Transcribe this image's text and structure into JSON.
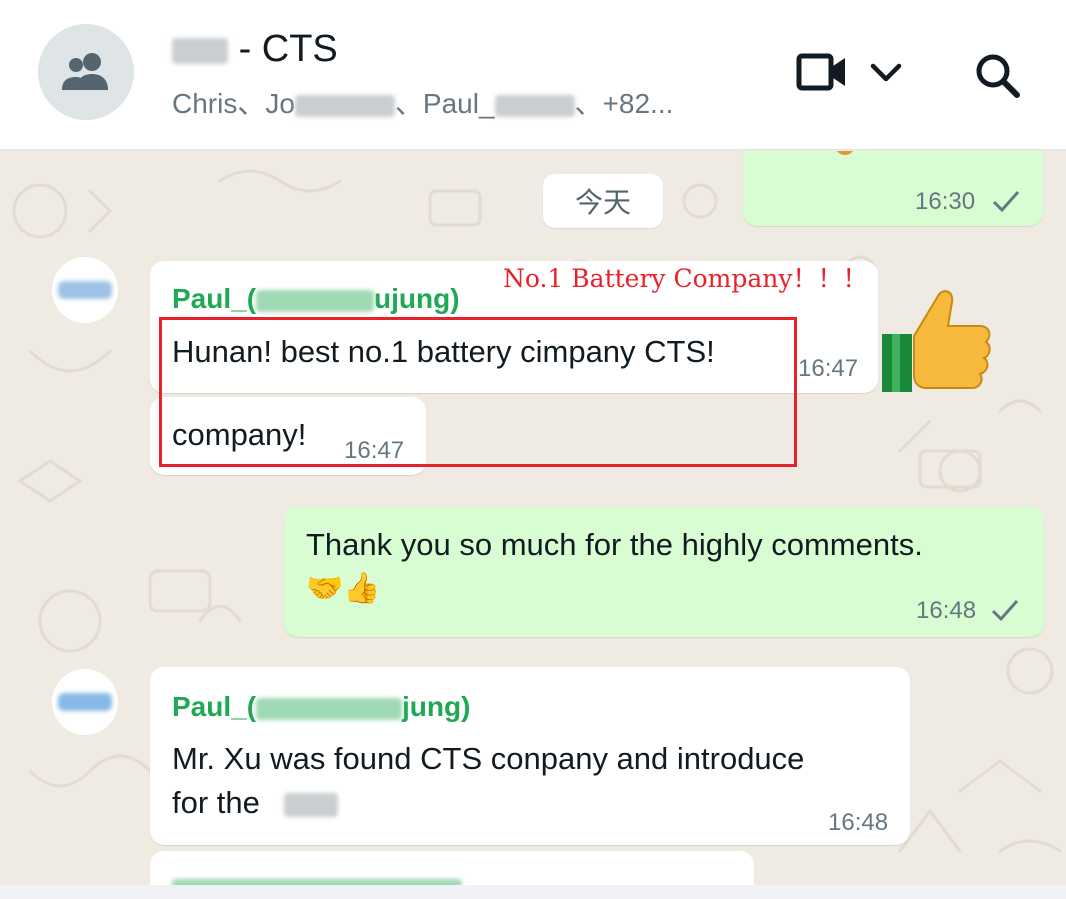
{
  "header": {
    "title": "- CTS",
    "members_text_1": "Chris、Jo",
    "members_text_2": "、Paul_",
    "members_text_3": "、+82...",
    "icons": [
      "group-icon",
      "video-call-icon",
      "chevron-down-icon",
      "search-icon"
    ]
  },
  "date_chip": "今天",
  "annotation": {
    "text": "No.1 Battery Company！！！",
    "color": "#e8222a"
  },
  "messages": [
    {
      "direction": "out",
      "text": "",
      "time": "16:30"
    },
    {
      "direction": "in",
      "sender": "Paul_(",
      "sender_suffix": "ujung)",
      "text": "Hunan!  best no.1 battery cimpany CTS!",
      "time": "16:47"
    },
    {
      "direction": "in",
      "text": "company!",
      "time": "16:47"
    },
    {
      "direction": "out",
      "text": "Thank you so much for the highly comments.",
      "emoji": "🤝👍",
      "time": "16:48"
    },
    {
      "direction": "in",
      "sender": "Paul_(",
      "sender_suffix": "jung)",
      "text_line1": "Mr. Xu was found  CTS conpany and introduce",
      "text_line2": "for the",
      "time": "16:48"
    }
  ],
  "colors": {
    "header_bg": "#ffffff",
    "chat_bg": "#efeae2",
    "incoming_bubble": "#ffffff",
    "outgoing_bubble": "#d9fdd3",
    "sender_name": "#1fa855",
    "annotation_red": "#e8222a"
  }
}
